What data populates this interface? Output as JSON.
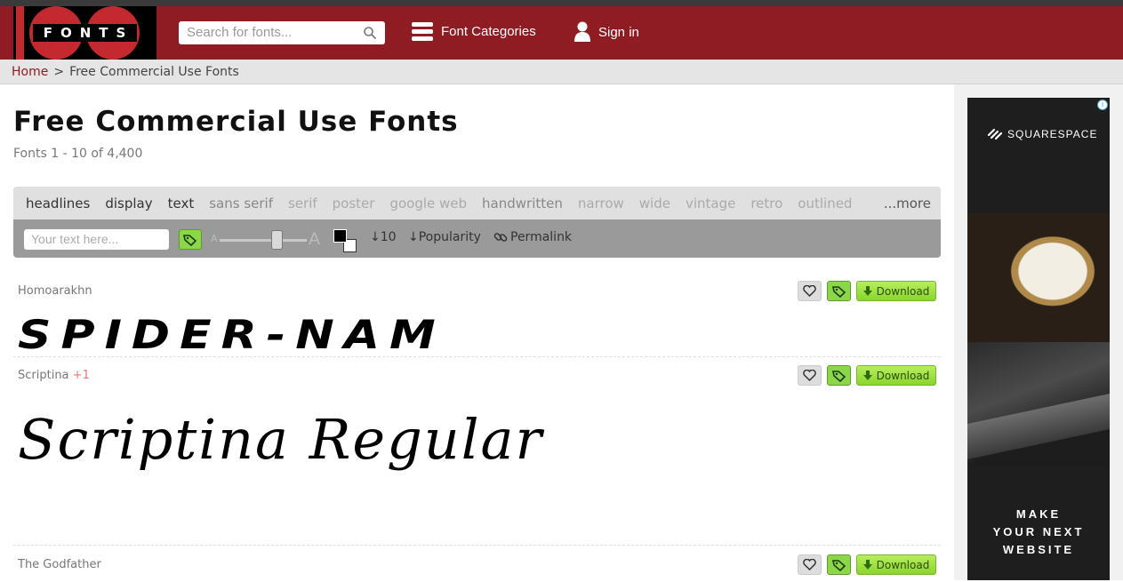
{
  "header": {
    "logo_text": "FONTS",
    "search_placeholder": "Search for fonts...",
    "nav_categories": "Font Categories",
    "nav_signin": "Sign in"
  },
  "breadcrumb": {
    "home": "Home",
    "separator": ">",
    "current": "Free Commercial Use Fonts"
  },
  "page": {
    "title": "Free Commercial Use Fonts",
    "count": "Fonts 1 - 10 of 4,400"
  },
  "filters": {
    "tags": [
      "headlines",
      "display",
      "text",
      "sans serif",
      "serif",
      "poster",
      "google web",
      "handwritten",
      "narrow",
      "wide",
      "vintage",
      "retro",
      "outlined"
    ],
    "more": "...more"
  },
  "tools": {
    "text_placeholder": "Your text here...",
    "size_small": "A",
    "size_large": "A",
    "per_page": "10",
    "sort": "Popularity",
    "permalink": "Permalink"
  },
  "fonts": [
    {
      "name": "Homoarakhn",
      "extra": "",
      "preview": "SPIDER-NAM",
      "download": "Download"
    },
    {
      "name": "Scriptina",
      "extra": "+1",
      "preview": "Scriptina Regular",
      "download": "Download"
    },
    {
      "name": "The Godfather",
      "extra": "",
      "preview": "",
      "download": "Download"
    }
  ],
  "ad": {
    "brand": "SQUARESPACE",
    "cta_line1": "MAKE",
    "cta_line2": "YOUR NEXT",
    "cta_line3": "WEBSITE",
    "info": "i"
  },
  "colors": {
    "header_bg": "#8e1c22",
    "accent_green": "#8cd64a",
    "link": "#8e1c22"
  }
}
